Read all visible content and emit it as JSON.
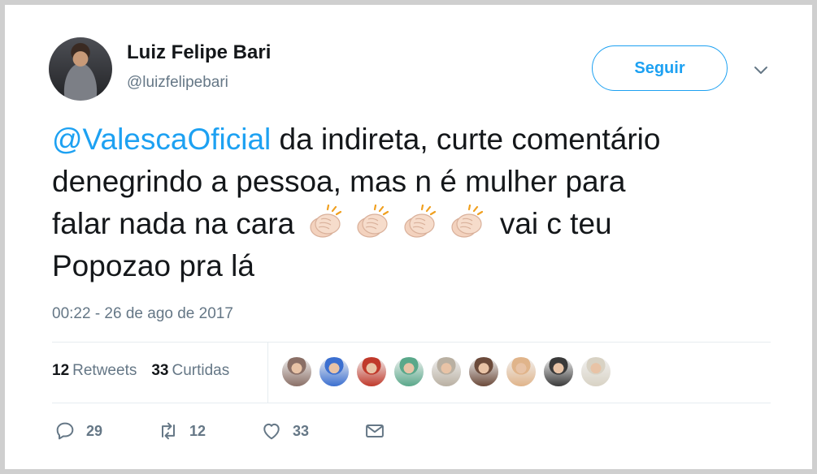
{
  "author": {
    "name": "Luiz Felipe Bari",
    "handle": "@luizfelipebari"
  },
  "follow_button": {
    "label": "Seguir"
  },
  "tweet": {
    "mention": "@ValescaOficial",
    "line1_rest": " da indireta, curte comentário",
    "line2": "denegrindo a pessoa, mas n é mulher para",
    "line3_start": "falar nada na cara ",
    "emoji": "clapping-hands",
    "emoji_count": 4,
    "line3_end": " vai c teu",
    "line4": "Popozao pra lá"
  },
  "timestamp": "00:22 - 26 de ago de 2017",
  "stats": {
    "retweets_count": "12",
    "retweets_label": "Retweets",
    "likes_count": "33",
    "likes_label": "Curtidas"
  },
  "liker_avatars": [
    {
      "color": "#8a6f66"
    },
    {
      "color": "#3b6fd0"
    },
    {
      "color": "#c0392b"
    },
    {
      "color": "#5aa88a"
    },
    {
      "color": "#b9b0a2"
    },
    {
      "color": "#6b4a3a"
    },
    {
      "color": "#e0b48a"
    },
    {
      "color": "#3a3a3a"
    },
    {
      "color": "#d8d2c4"
    }
  ],
  "actions": {
    "reply_count": "29",
    "retweet_count": "12",
    "like_count": "33"
  },
  "colors": {
    "accent": "#1da1f2",
    "text": "#14171a",
    "muted": "#657786"
  }
}
